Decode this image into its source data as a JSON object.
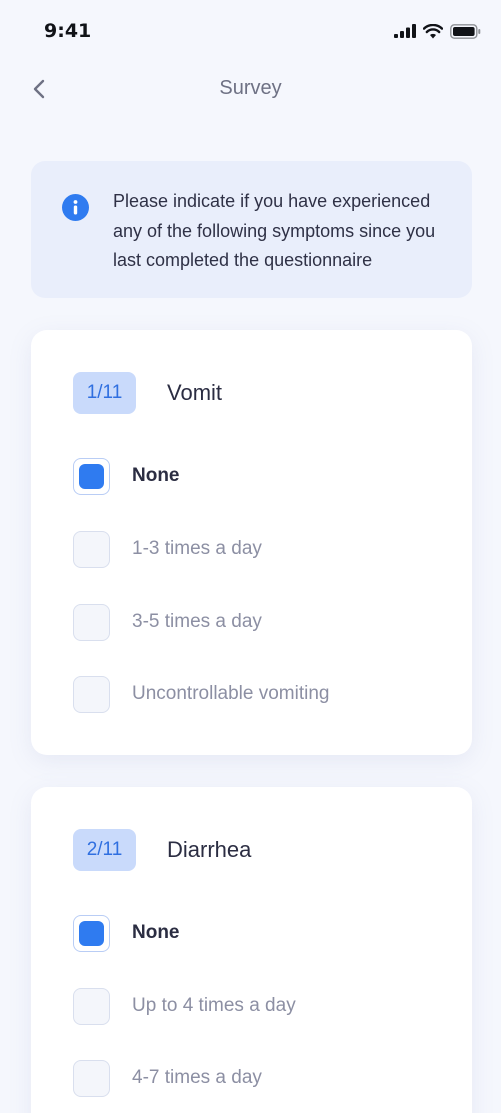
{
  "status_bar": {
    "time": "9:41"
  },
  "nav": {
    "title": "Survey"
  },
  "info": {
    "line1": "Please indicate if you have experienced",
    "line2": "any of the following symptoms since you",
    "line3": "last completed the questionnaire"
  },
  "colors": {
    "accent": "#2f7bf0",
    "badge_bg": "#c9dafb",
    "info_bg": "#e9eefb",
    "page_bg": "#f5f7fd"
  },
  "questions": [
    {
      "badge": "1/11",
      "title": "Vomit",
      "options": [
        {
          "label": "None",
          "selected": true
        },
        {
          "label": "1-3 times a day",
          "selected": false
        },
        {
          "label": "3-5 times a day",
          "selected": false
        },
        {
          "label": "Uncontrollable vomiting",
          "selected": false
        }
      ]
    },
    {
      "badge": "2/11",
      "title": "Diarrhea",
      "options": [
        {
          "label": "None",
          "selected": true
        },
        {
          "label": "Up to 4 times a day",
          "selected": false
        },
        {
          "label": "4-7 times a day",
          "selected": false
        }
      ]
    }
  ]
}
